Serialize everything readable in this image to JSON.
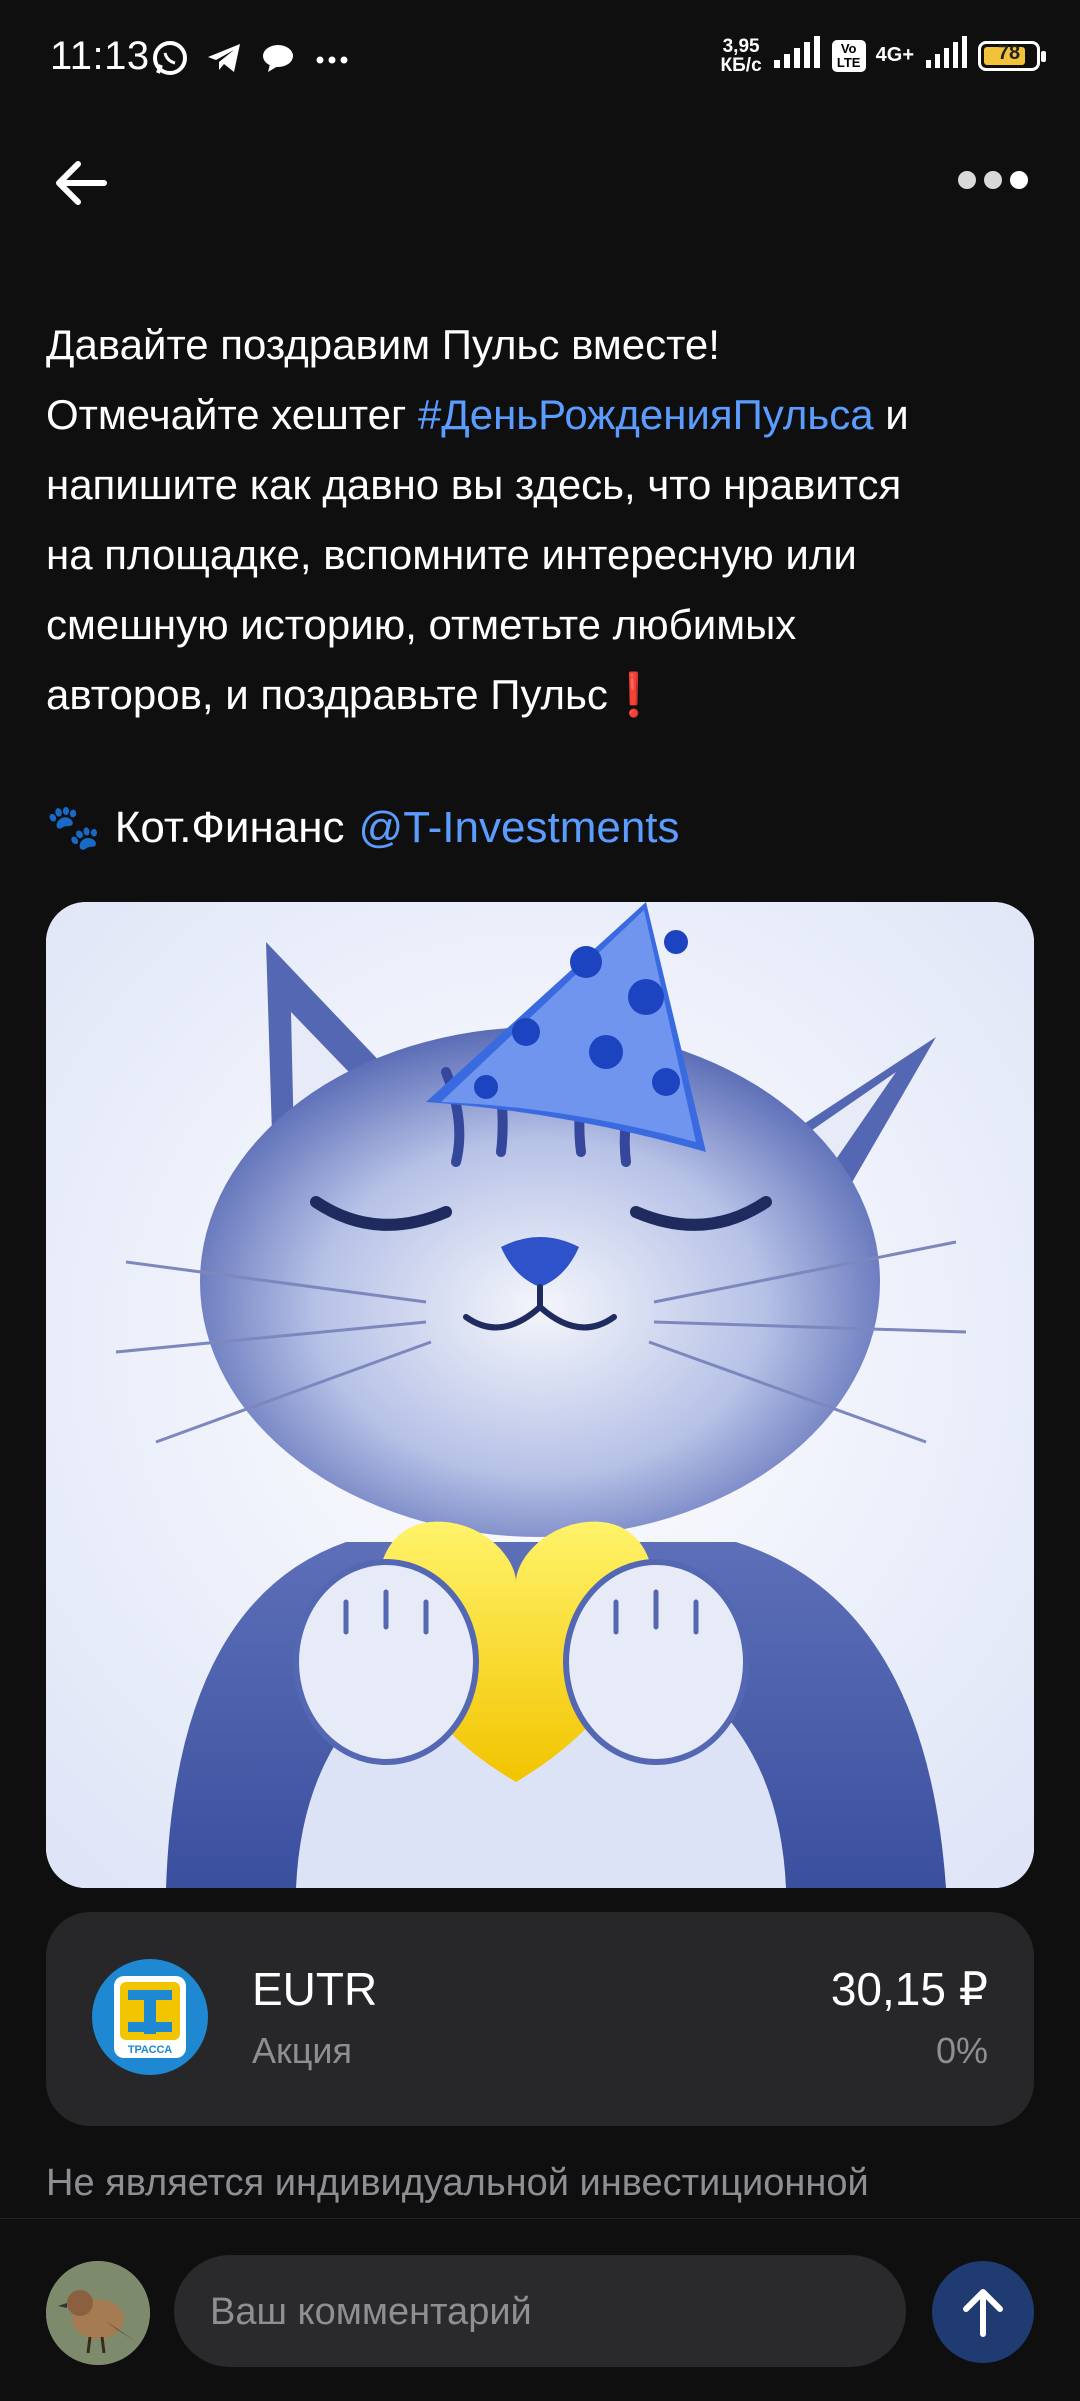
{
  "status_bar": {
    "time": "11:13",
    "speed_value": "3,95",
    "speed_unit": "КБ/с",
    "volte": "Vo LTE",
    "network": "4G+",
    "battery": "78",
    "notification_icons": [
      "whatsapp-icon",
      "telegram-icon",
      "chat-bubble-icon",
      "more-dots-icon"
    ]
  },
  "post": {
    "line1": "Давайте поздравим Пульс вместе!",
    "line2_prefix": "Отмечайте хештег ",
    "hashtag": "#ДеньРожденияПульса",
    "line2_suffix": " и",
    "line3": "напишите как давно вы здесь, что нравится",
    "line4": "на площадке, вспомните интересную или",
    "line5": "смешную историю, отметьте любимых",
    "line6": "авторов, и поздравьте Пульс",
    "exclamation": "❗",
    "author_emoji": "🐾",
    "author_name": "Кот.Финанс",
    "mention": "@T-Investments"
  },
  "stock": {
    "ticker": "EUTR",
    "type": "Акция",
    "price": "30,15 ₽",
    "change": "0%",
    "logo_text": "ТРАССА"
  },
  "disclaimer": "Не является индивидуальной инвестиционной",
  "comment": {
    "placeholder": "Ваш комментарий"
  },
  "colors": {
    "background": "#0f0f10",
    "accent_link": "#5b9cff",
    "card": "#272729",
    "send_button": "#1f3b72"
  }
}
